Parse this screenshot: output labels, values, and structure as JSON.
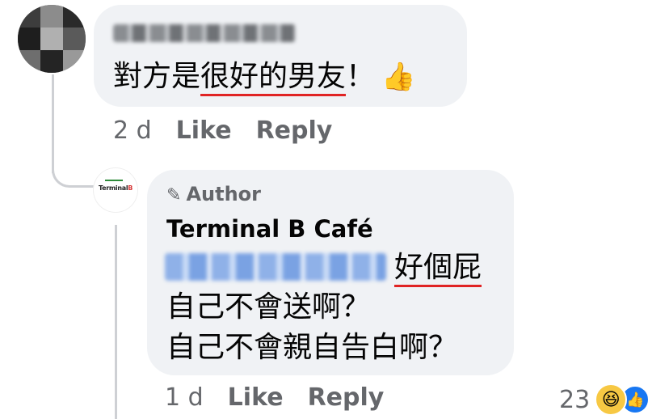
{
  "comment": {
    "text_part1": "對方是",
    "text_highlight": "很好的男友",
    "text_part2": "！",
    "emoji": "👍",
    "age": "2 d",
    "like_label": "Like",
    "reply_label": "Reply"
  },
  "reply": {
    "author_badge": "Author",
    "page_name": "Terminal B Café",
    "highlight": "好個屁",
    "line2": "自己不會送啊？",
    "line3": "自己不會親自告白啊？",
    "age": "1 d",
    "like_label": "Like",
    "reply_label": "Reply",
    "reaction_count": "23",
    "reaction_icons": [
      "haha-icon",
      "like-icon"
    ]
  },
  "colors": {
    "bubble": "#f0f2f5",
    "meta_gray": "#65676b",
    "underline_red": "#e02424",
    "like_blue": "#1877f2"
  }
}
